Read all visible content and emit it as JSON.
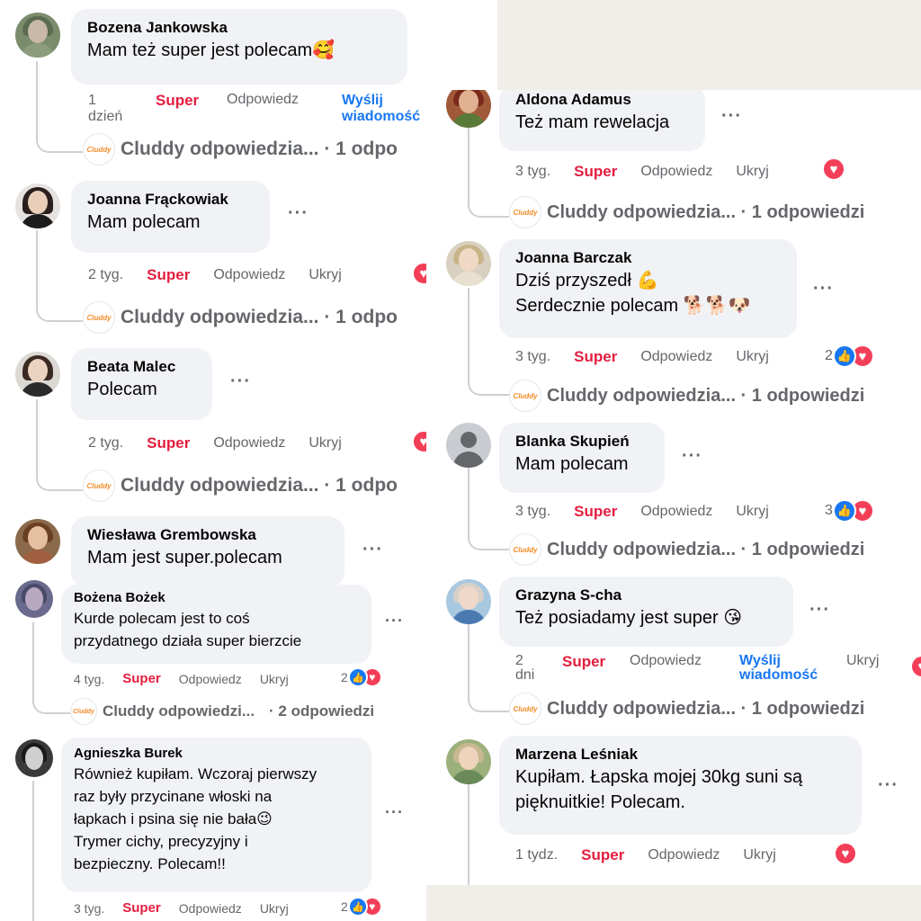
{
  "common": {
    "super": "Super",
    "reply": "Odpowiedz",
    "hide": "Ukryj",
    "send_msg_line1": "Wyślij",
    "send_msg_line2": "wiadomość",
    "cluddy_logo": "Cluddy"
  },
  "left": [
    {
      "name": "Bozena Jankowska",
      "text": "Mam też super jest polecam🥰",
      "time_line1": "1",
      "time_line2": "dzień",
      "reply_summary": "Cluddy odpowiedzia... · 1 odpo"
    },
    {
      "name": "Joanna Frąckowiak",
      "text": "Mam polecam",
      "time": "2 tyg.",
      "reply_summary": "Cluddy odpowiedzia... · 1 odpo"
    },
    {
      "name": "Beata Malec",
      "text": "Polecam",
      "time": "2 tyg.",
      "reply_summary": "Cluddy odpowiedzia... · 1 odpo"
    },
    {
      "name": "Wiesława Grembowska",
      "text": "Mam jest super.polecam"
    },
    {
      "name": "Bożena Bożek",
      "text_line1": "Kurde polecam jest to coś",
      "text_line2": "przydatnego działa super bierzcie",
      "time": "4 tyg.",
      "reactions": "2",
      "reply_summary_left": "Cluddy odpowiedzi...",
      "reply_summary_right": "· 2 odpowiedzi"
    },
    {
      "name": "Agnieszka Burek",
      "text_line1": "Również kupiłam. Wczoraj pierwszy",
      "text_line2": "raz były przycinane włoski na",
      "text_line3": "łapkach i psina się nie bała😉",
      "text_line4": "Trymer cichy, precyzyjny i",
      "text_line5": "bezpieczny. Polecam!!",
      "time": "3 tyg.",
      "reactions": "2"
    }
  ],
  "right": [
    {
      "name": "Aldona Adamus",
      "text": "Też mam rewelacja",
      "time": "3 tyg.",
      "reply_summary": "Cluddy odpowiedzia... · 1 odpowiedzi"
    },
    {
      "name": "Joanna Barczak",
      "text_line1": "Dziś przyszedł 💪",
      "text_line2": "Serdecznie polecam 🐕🐕🐶",
      "time": "3 tyg.",
      "reactions": "2",
      "reply_summary": "Cluddy odpowiedzia... · 1 odpowiedzi"
    },
    {
      "name": "Blanka Skupień",
      "text": "Mam polecam",
      "time": "3 tyg.",
      "reactions": "3",
      "reply_summary": "Cluddy odpowiedzia... · 1 odpowiedzi"
    },
    {
      "name": "Grazyna S-cha",
      "text": "Też posiadamy jest super 😘",
      "time_line1": "2",
      "time_line2": "dni",
      "reply_summary": "Cluddy odpowiedzia... · 1 odpowiedzi"
    },
    {
      "name": "Marzena Leśniak",
      "text_line1": "Kupiłam. Łapska mojej 30kg suni są",
      "text_line2": "pięknuitkie! Polecam.",
      "time": "1 tydz."
    }
  ],
  "colors": {
    "super": "#e41e3f",
    "link": "#1877f2",
    "bubble": "#f0f2f5",
    "muted": "#65676b",
    "heart": "#f33e58",
    "beige": "#f1ede8"
  },
  "icons": [
    "more-dots-icon",
    "heart-reaction-icon",
    "like-reaction-icon",
    "cluddy-logo-icon",
    "default-avatar-icon"
  ]
}
